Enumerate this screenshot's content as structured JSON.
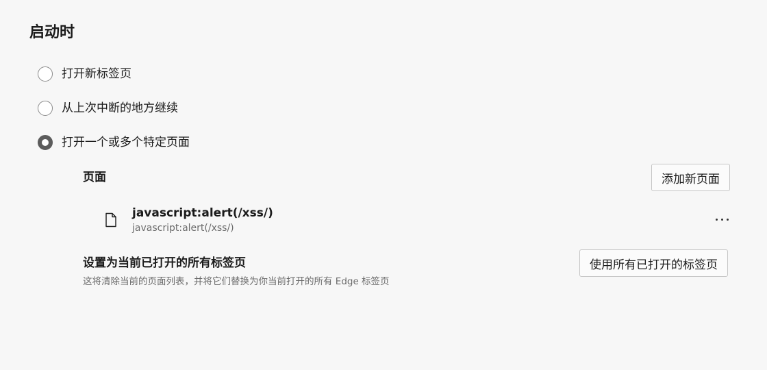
{
  "startup": {
    "title": "启动时",
    "options": [
      {
        "label": "打开新标签页",
        "selected": false
      },
      {
        "label": "从上次中断的地方继续",
        "selected": false
      },
      {
        "label": "打开一个或多个特定页面",
        "selected": true
      }
    ]
  },
  "pages": {
    "heading": "页面",
    "add_button": "添加新页面",
    "items": [
      {
        "icon": "document-icon",
        "title": "javascript:alert(/xss/)",
        "url": "javascript:alert(/xss/)",
        "more_icon": "more-horizontal-icon"
      }
    ]
  },
  "set_current": {
    "heading": "设置为当前已打开的所有标签页",
    "description": "这将清除当前的页面列表，并将它们替换为你当前打开的所有 Edge 标签页",
    "button": "使用所有已打开的标签页"
  }
}
